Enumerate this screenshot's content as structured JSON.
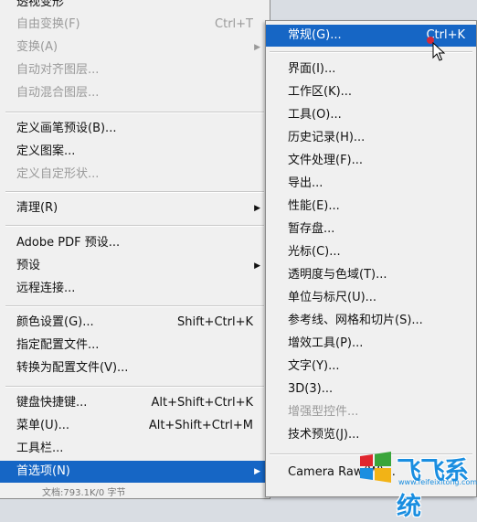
{
  "main_menu": {
    "items": [
      {
        "label": "透视变形",
        "shortcut": "",
        "disabled": false
      },
      {
        "label": "自由变换(F)",
        "shortcut": "Ctrl+T",
        "disabled": true
      },
      {
        "label": "变换(A)",
        "shortcut": "",
        "disabled": true,
        "submenu": true
      },
      {
        "label": "自动对齐图层...",
        "shortcut": "",
        "disabled": true
      },
      {
        "label": "自动混合图层...",
        "shortcut": "",
        "disabled": true
      },
      {
        "label": "定义画笔预设(B)...",
        "shortcut": "",
        "disabled": false
      },
      {
        "label": "定义图案...",
        "shortcut": "",
        "disabled": false
      },
      {
        "label": "定义自定形状...",
        "shortcut": "",
        "disabled": true
      },
      {
        "label": "清理(R)",
        "shortcut": "",
        "disabled": false,
        "submenu": true
      },
      {
        "label": "Adobe PDF 预设...",
        "shortcut": "",
        "disabled": false
      },
      {
        "label": "预设",
        "shortcut": "",
        "disabled": false,
        "submenu": true
      },
      {
        "label": "远程连接...",
        "shortcut": "",
        "disabled": false
      },
      {
        "label": "颜色设置(G)...",
        "shortcut": "Shift+Ctrl+K",
        "disabled": false
      },
      {
        "label": "指定配置文件...",
        "shortcut": "",
        "disabled": false
      },
      {
        "label": "转换为配置文件(V)...",
        "shortcut": "",
        "disabled": false
      },
      {
        "label": "键盘快捷键...",
        "shortcut": "Alt+Shift+Ctrl+K",
        "disabled": false
      },
      {
        "label": "菜单(U)...",
        "shortcut": "Alt+Shift+Ctrl+M",
        "disabled": false
      },
      {
        "label": "工具栏...",
        "shortcut": "",
        "disabled": false
      },
      {
        "label": "首选项(N)",
        "shortcut": "",
        "disabled": false,
        "submenu": true,
        "highlighted": true
      }
    ],
    "status_text": "文档:793.1K/0 字节"
  },
  "sub_menu": {
    "items": [
      {
        "label": "常规(G)...",
        "shortcut": "Ctrl+K",
        "highlighted": true
      },
      {
        "label": "界面(I)..."
      },
      {
        "label": "工作区(K)..."
      },
      {
        "label": "工具(O)..."
      },
      {
        "label": "历史记录(H)..."
      },
      {
        "label": "文件处理(F)..."
      },
      {
        "label": "导出..."
      },
      {
        "label": "性能(E)..."
      },
      {
        "label": "暂存盘..."
      },
      {
        "label": "光标(C)..."
      },
      {
        "label": "透明度与色域(T)..."
      },
      {
        "label": "单位与标尺(U)..."
      },
      {
        "label": "参考线、网格和切片(S)..."
      },
      {
        "label": "增效工具(P)..."
      },
      {
        "label": "文字(Y)..."
      },
      {
        "label": "3D(3)..."
      },
      {
        "label": "增强型控件...",
        "disabled": true
      },
      {
        "label": "技术预览(J)..."
      },
      {
        "label": "Camera Raw(W)..."
      }
    ]
  },
  "watermark": {
    "text": "飞飞系统",
    "url": "www.feifeixitong.com",
    "colors": {
      "blue": "#1a8ee0",
      "red": "#e0262e",
      "green": "#3aa53a",
      "yellow": "#f2b316"
    }
  },
  "colors": {
    "highlight": "#1666c5",
    "menu_bg": "#f0f0f0",
    "disabled_text": "#9a9a9a"
  }
}
